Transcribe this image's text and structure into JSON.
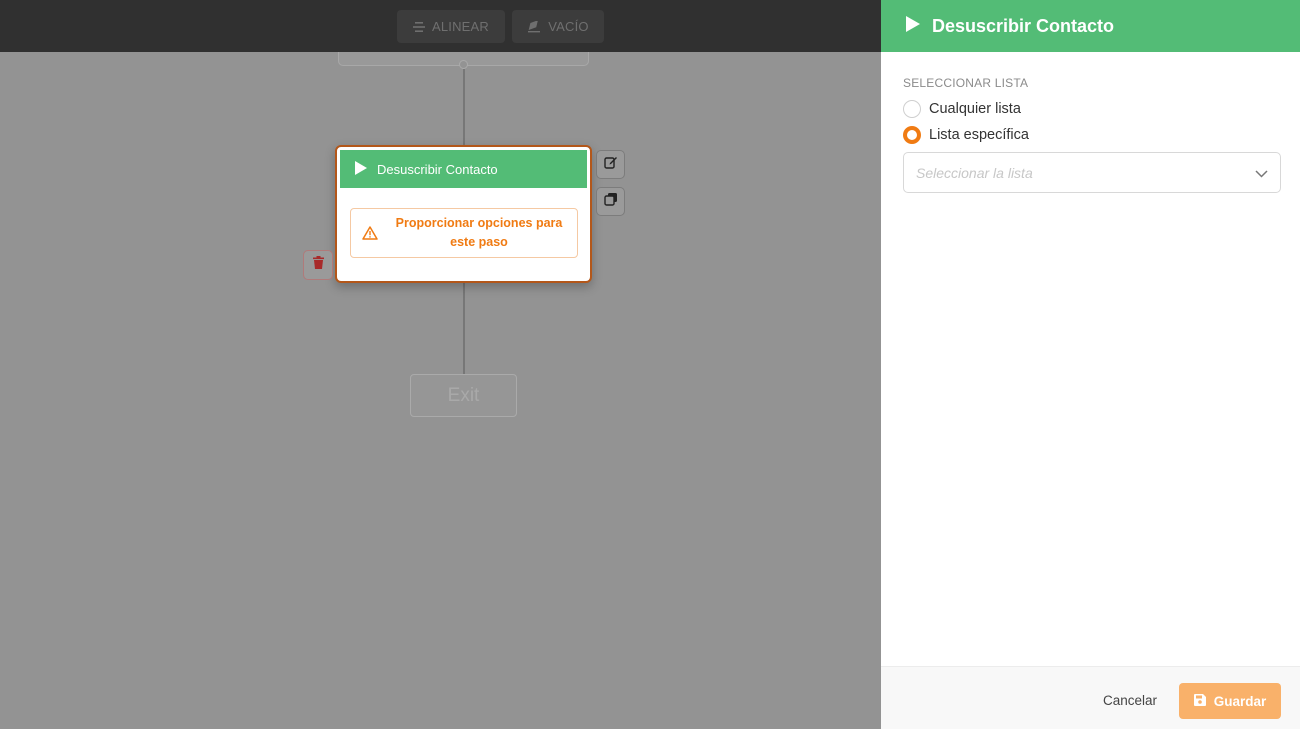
{
  "toolbar": {
    "align_label": "ALINEAR",
    "empty_label": "VACÍO"
  },
  "node": {
    "title": "Desuscribir Contacto",
    "warning": "Proporcionar opciones para este paso",
    "border_color": "#b3571a",
    "header_color": "#53bc76",
    "warning_color": "#f07b13"
  },
  "exit_node": {
    "label": "Exit"
  },
  "panel": {
    "title": "Desuscribir Contacto",
    "section_label": "SELECCIONAR LISTA",
    "radio_options": [
      {
        "label": "Cualquier lista",
        "checked": false
      },
      {
        "label": "Lista específica",
        "checked": true
      }
    ],
    "select_placeholder": "Seleccionar la lista",
    "cancel_label": "Cancelar",
    "save_label": "Guardar"
  },
  "colors": {
    "accent_green": "#53bc76",
    "accent_orange": "#f07b13",
    "save_button": "#f9b16a"
  }
}
